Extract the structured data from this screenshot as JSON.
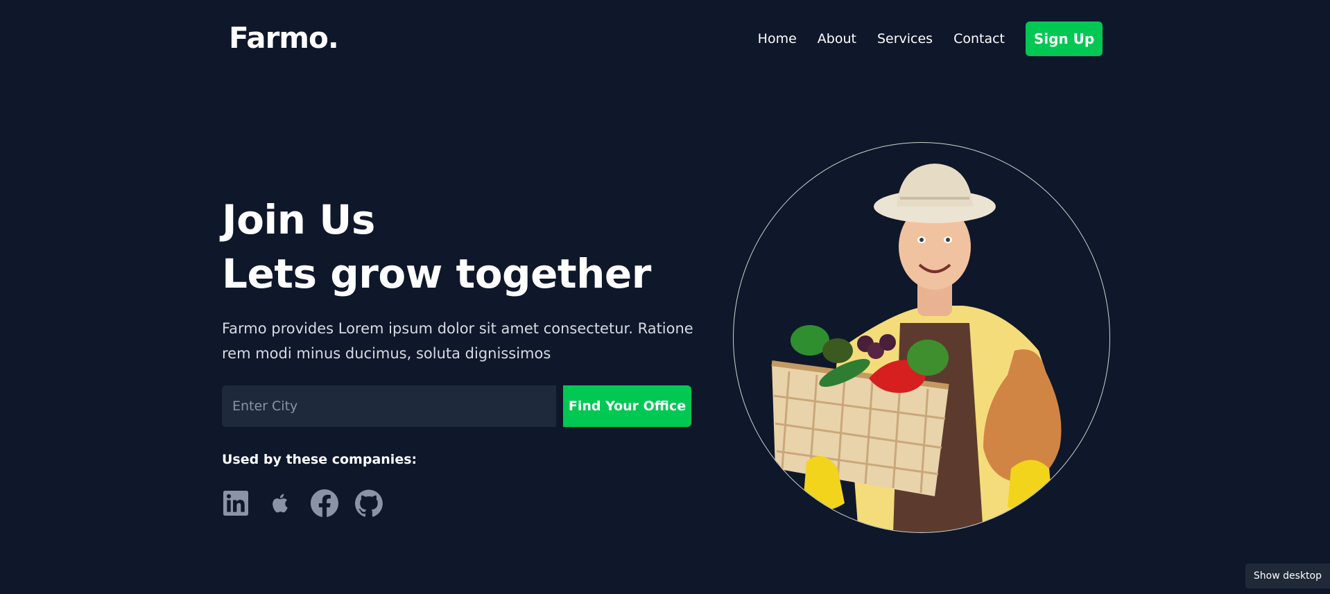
{
  "brand": {
    "logo": "Farmo."
  },
  "nav": {
    "items": [
      "Home",
      "About",
      "Services",
      "Contact"
    ],
    "signup_label": "Sign Up"
  },
  "hero": {
    "title_line1": "Join Us",
    "title_line2": "Lets grow together",
    "description": "Farmo provides Lorem ipsum dolor sit amet consectetur. Ratione rem modi minus ducimus, soluta dignissimos",
    "search": {
      "placeholder": "Enter City",
      "value": "",
      "button_label": "Find Your Office"
    },
    "used_by_label": "Used by these companies:",
    "companies": [
      "linkedin-icon",
      "apple-icon",
      "facebook-icon",
      "github-icon"
    ],
    "image": "farmer-with-vegetables"
  },
  "taskbar": {
    "show_desktop": "Show desktop"
  },
  "colors": {
    "background": "#0f172a",
    "accent": "#00c853",
    "input_bg": "#1e293b",
    "icon": "#8a94a6"
  }
}
